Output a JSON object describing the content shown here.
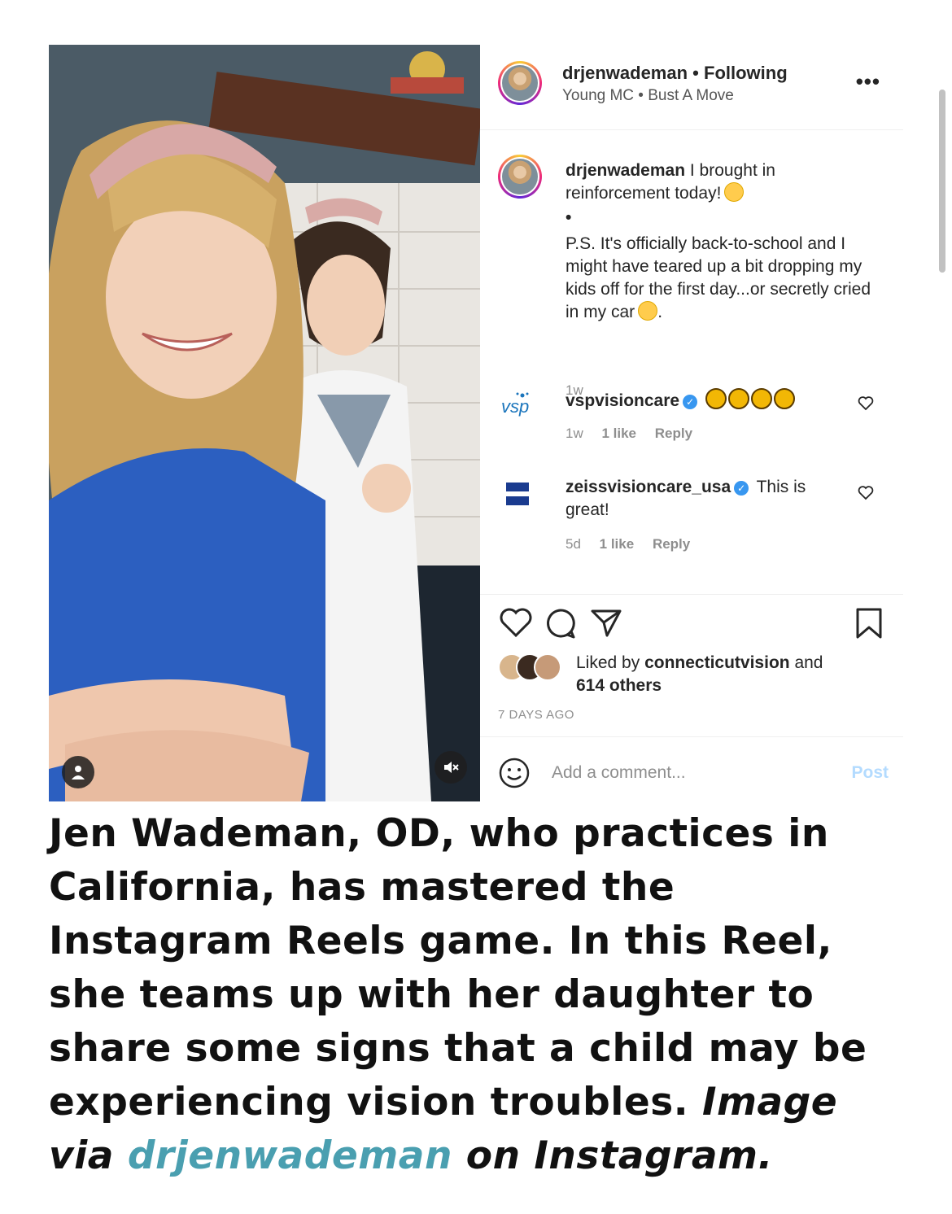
{
  "header": {
    "username": "drjenwademan",
    "separator": "•",
    "follow_status": "Following",
    "audio": "Young MC • Bust A Move",
    "more_label": "•••"
  },
  "caption": {
    "username": "drjenwademan",
    "line1": "I brought in reinforcement today!",
    "bullet": "•",
    "ps": "P.S. It's officially back-to-school and I might have teared up a bit dropping my kids off for the first day...or secretly cried in my car",
    "ps_end": ".",
    "time": "1w"
  },
  "comments": [
    {
      "avatar_text": "vsp",
      "username": "vspvisioncare",
      "text": "",
      "time": "1w",
      "likes": "1 like",
      "reply": "Reply"
    },
    {
      "avatar_text": "ZEISS",
      "username": "zeissvisioncare_usa",
      "text": "This is great!",
      "time": "5d",
      "likes": "1 like",
      "reply": "Reply"
    }
  ],
  "likes": {
    "prefix": "Liked by",
    "user": "connecticutvision",
    "suffix": "and",
    "others": "614 others"
  },
  "post_date": "7 DAYS AGO",
  "comment_box": {
    "placeholder": "Add a comment...",
    "post_label": "Post"
  },
  "article": {
    "caption": "Jen Wademan, OD, who practices in California, has mastered the Instagram Reels game. In this Reel, she teams up with her daughter to share some signs that a child may be experiencing vision troubles.",
    "credit_prefix": "Image via",
    "credit_handle": "drjenwademan",
    "credit_suffix": "on Instagram."
  },
  "colors": {
    "verified": "#3897f0",
    "post_button": "#b3dbff",
    "handle_link": "#4a9fb0",
    "vsp_brand": "#1b75bc",
    "zeiss_brand": "#1a3b8f"
  },
  "icons": [
    "user-icon",
    "mute-icon",
    "more-icon",
    "verified-icon",
    "heart-icon",
    "comment-icon",
    "share-icon",
    "bookmark-icon",
    "smiley-icon"
  ]
}
